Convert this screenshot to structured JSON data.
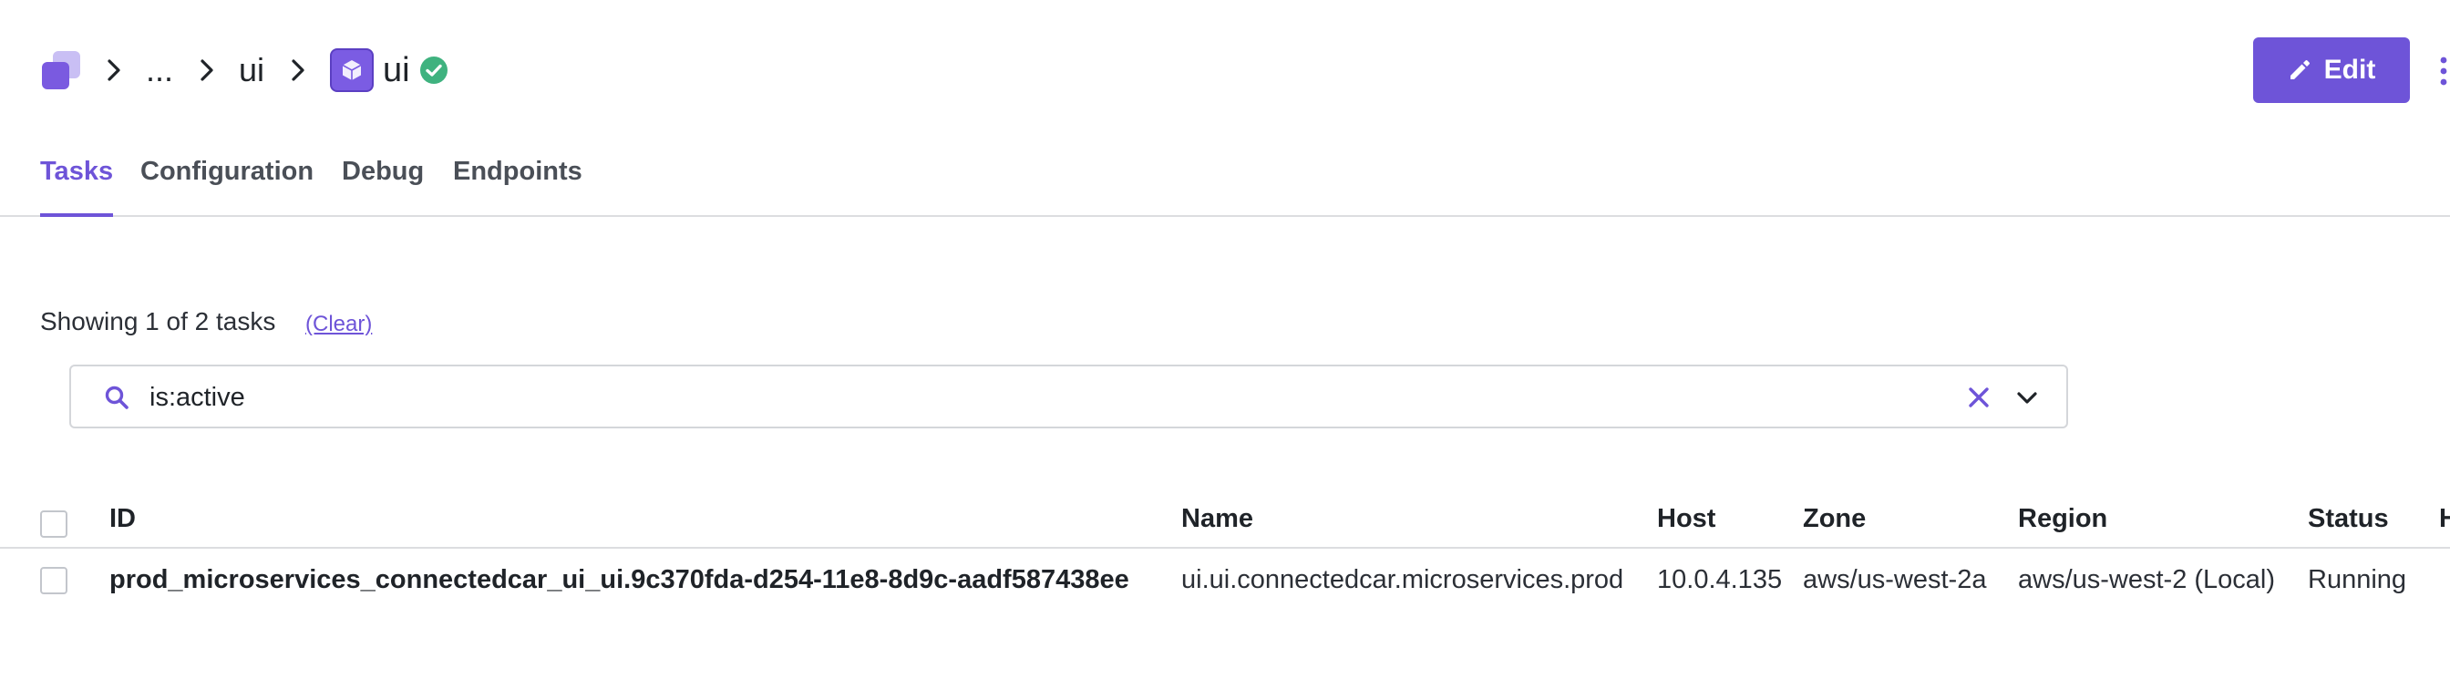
{
  "colors": {
    "accent": "#6e54d8",
    "success": "#3fb27f",
    "border": "#dcdde0",
    "text": "#1f2328"
  },
  "breadcrumb": {
    "ellipsis": "...",
    "parent": "ui",
    "current": "ui",
    "status_icon": "check-circle-icon"
  },
  "actions": {
    "edit_label": "Edit",
    "edit_icon": "pencil-icon",
    "more_icon": "kebab-menu-icon"
  },
  "tabs": [
    {
      "label": "Tasks",
      "active": true
    },
    {
      "label": "Configuration",
      "active": false
    },
    {
      "label": "Debug",
      "active": false
    },
    {
      "label": "Endpoints",
      "active": false
    }
  ],
  "filter": {
    "summary": "Showing 1 of 2 tasks",
    "clear_label": "(Clear)"
  },
  "search": {
    "value": "is:active",
    "icon": "search-icon"
  },
  "table": {
    "columns": [
      "ID",
      "Name",
      "Host",
      "Zone",
      "Region",
      "Status",
      "H"
    ],
    "rows": [
      {
        "id": "prod_microservices_connectedcar_ui_ui.9c370fda-d254-11e8-8d9c-aadf587438ee",
        "name": "ui.ui.connectedcar.microservices.prod",
        "host": "10.0.4.135",
        "zone": "aws/us-west-2a",
        "region": "aws/us-west-2 (Local)",
        "status": "Running"
      }
    ]
  }
}
